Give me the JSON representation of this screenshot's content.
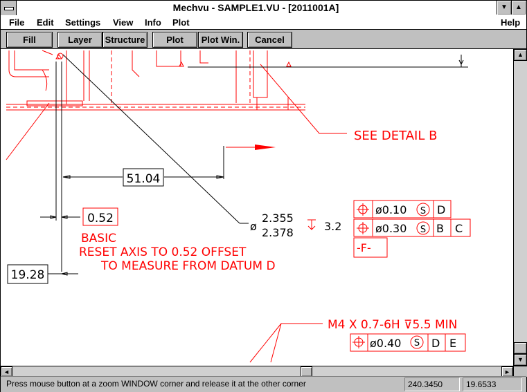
{
  "window": {
    "title": "Mechvu - SAMPLE1.VU - [2011001A]"
  },
  "menu": [
    {
      "label": "File"
    },
    {
      "label": "Edit"
    },
    {
      "label": "Settings"
    },
    {
      "label": "View"
    },
    {
      "label": "Info"
    },
    {
      "label": "Plot"
    }
  ],
  "menu_help": "Help",
  "toolbar": {
    "fill": "Fill",
    "layer": "Layer",
    "structure": "Structure",
    "plot": "Plot",
    "plot_win": "Plot Win.",
    "cancel": "Cancel"
  },
  "drawing": {
    "see_detail": "SEE DETAIL B",
    "dim_51": "51.04",
    "dim_052": "0.52",
    "basic": "BASIC",
    "reset1": "RESET AXIS TO 0.52 OFFSET",
    "reset2": "TO MEASURE FROM DATUM D",
    "dim_1928": "19.28",
    "dia_symbol": "ø",
    "dia_top": "2.355",
    "dia_bottom": "2.378",
    "depth": "3.2",
    "fcf1": [
      "ø0.10",
      "S",
      "D"
    ],
    "fcf2": [
      "ø0.30",
      "S",
      "B",
      "C"
    ],
    "datum_f": "-F-",
    "thread": "M4 X 0.7-6H ⊽5.5 MIN",
    "fcf3": [
      "ø0.40",
      "S",
      "D",
      "E"
    ]
  },
  "colors": {
    "drawing": "#ff0000",
    "dimension": "#000000"
  },
  "status": {
    "message": "Press mouse button at a zoom WINDOW corner and release it at the other corner",
    "x": "240.3450",
    "y": "19.6533"
  }
}
